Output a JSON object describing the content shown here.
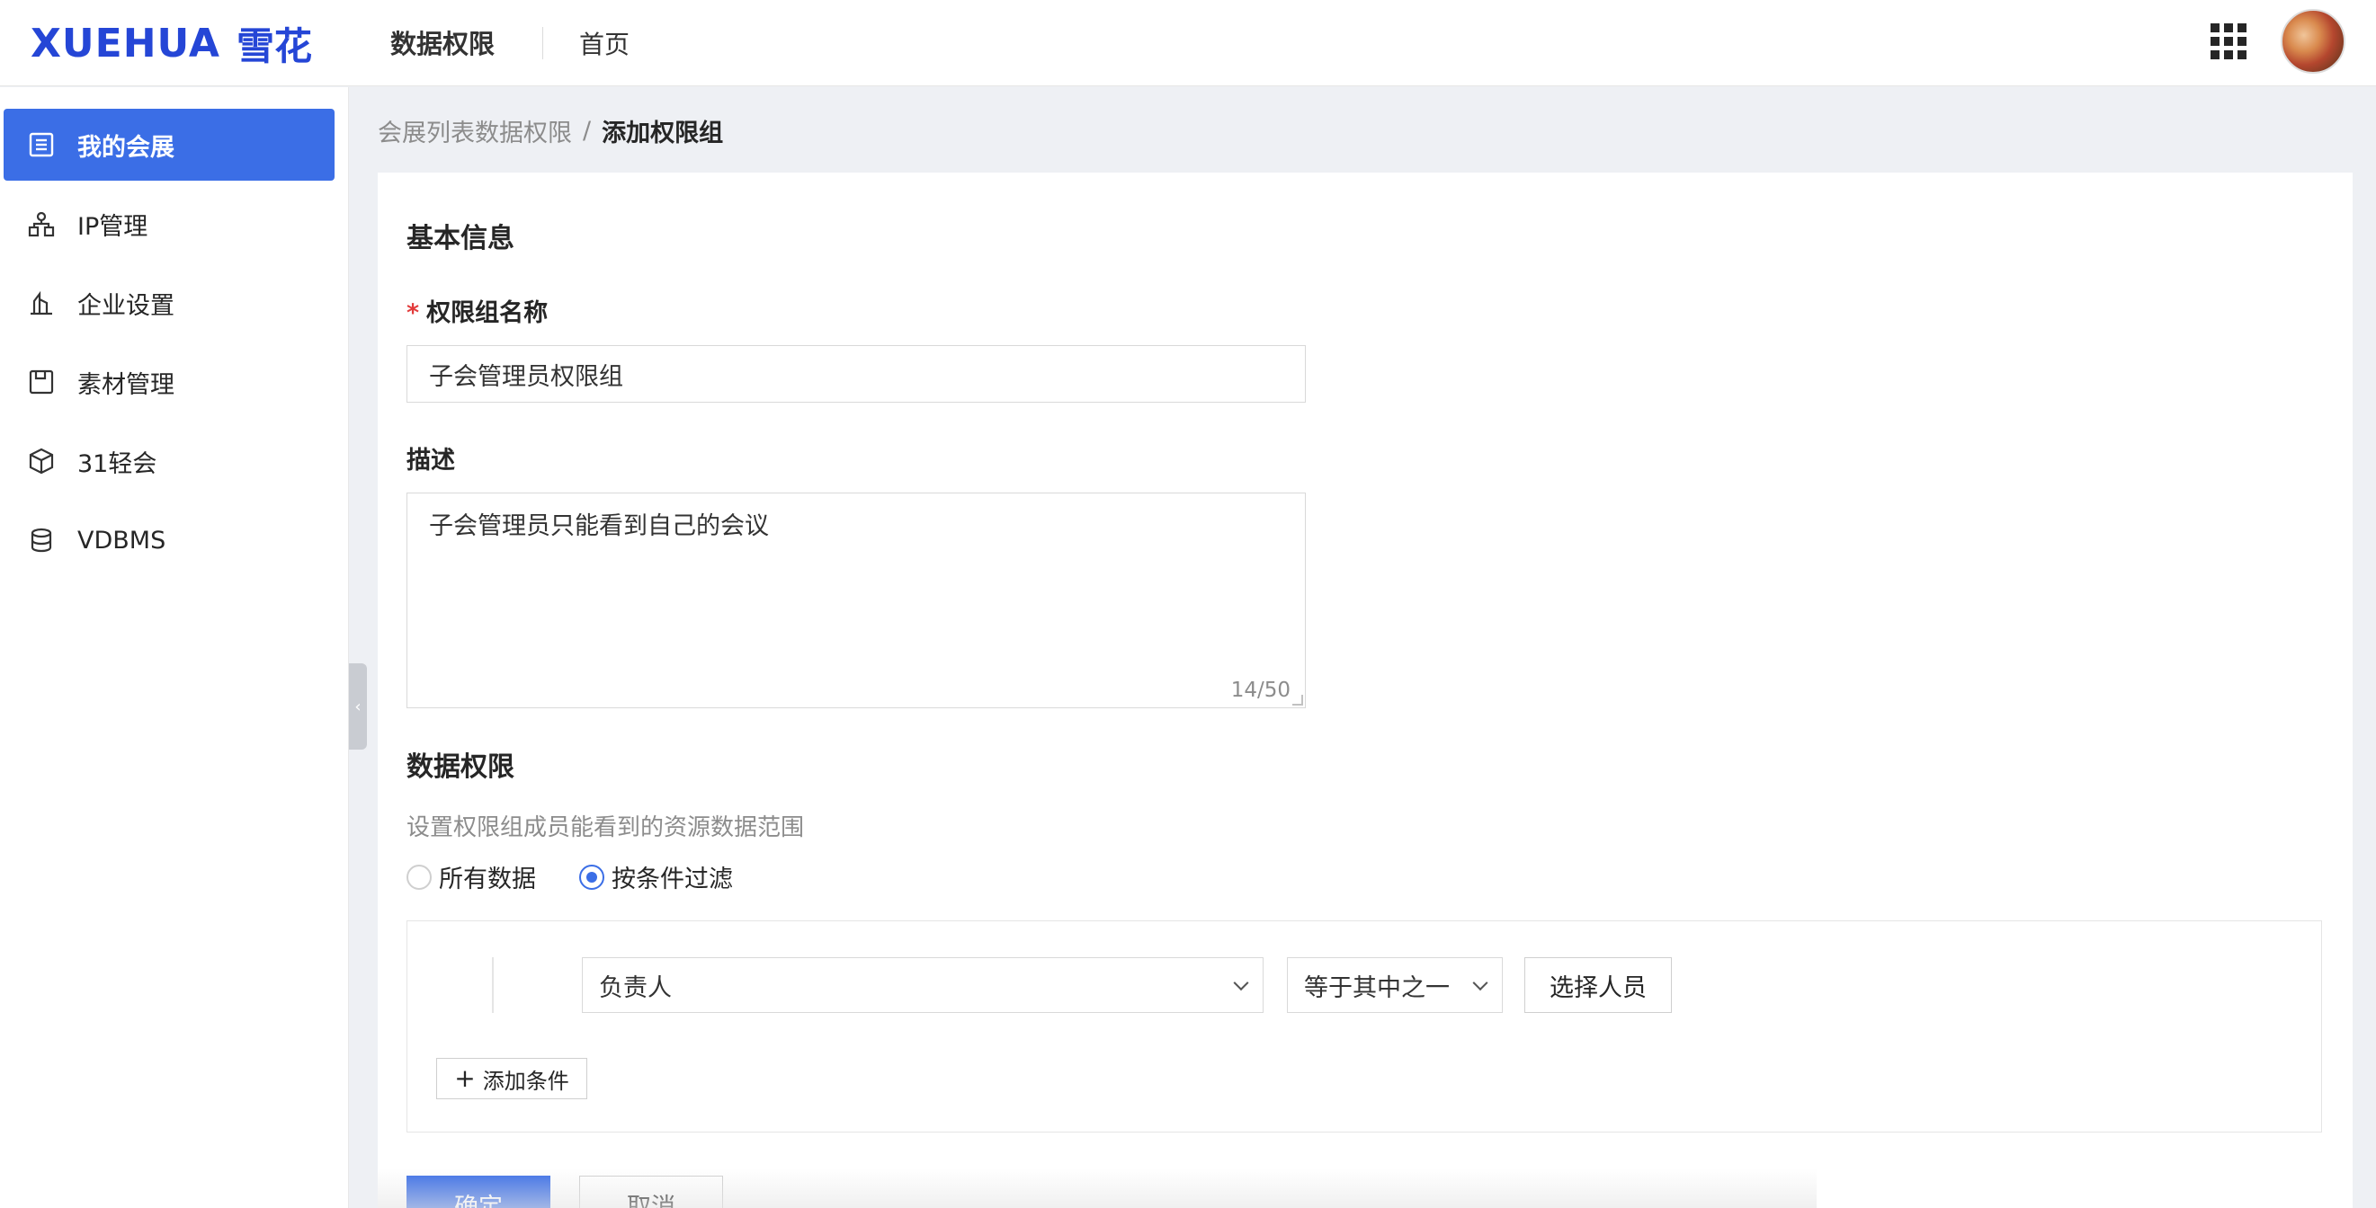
{
  "header": {
    "logo_text": "XUEHUA",
    "logo_cn": "雪花",
    "app_title": "数据权限",
    "nav_home": "首页",
    "apps_icon": "grid-icon",
    "avatar_icon": "user-avatar"
  },
  "sidebar": {
    "items": [
      {
        "label": "我的会展",
        "icon": "list-icon",
        "active": true
      },
      {
        "label": "IP管理",
        "icon": "network-icon",
        "active": false
      },
      {
        "label": "企业设置",
        "icon": "building-icon",
        "active": false
      },
      {
        "label": "素材管理",
        "icon": "save-icon",
        "active": false
      },
      {
        "label": "31轻会",
        "icon": "cube-icon",
        "active": false
      },
      {
        "label": "VDBMS",
        "icon": "database-icon",
        "active": false
      }
    ],
    "collapse_glyph": "‹"
  },
  "breadcrumb": {
    "parent": "会展列表数据权限",
    "separator": "/",
    "current": "添加权限组"
  },
  "form": {
    "basic_section_title": "基本信息",
    "name_required_mark": "*",
    "name_label": "权限组名称",
    "name_value": "子会管理员权限组",
    "desc_label": "描述",
    "desc_value": "子会管理员只能看到自己的会议",
    "desc_counter": "14/50",
    "data_section_title": "数据权限",
    "data_hint": "设置权限组成员能看到的资源数据范围",
    "radio_all": "所有数据",
    "radio_filter": "按条件过滤",
    "selected_radio": "filter",
    "condition": {
      "field_value": "负责人",
      "operator_value": "等于其中之一",
      "select_people_label": "选择人员"
    },
    "add_condition_label": "添加条件",
    "confirm_label": "确定",
    "cancel_label": "取消"
  },
  "colors": {
    "primary": "#3b6ee6",
    "logo": "#2546d6",
    "required": "#e23b3b"
  }
}
